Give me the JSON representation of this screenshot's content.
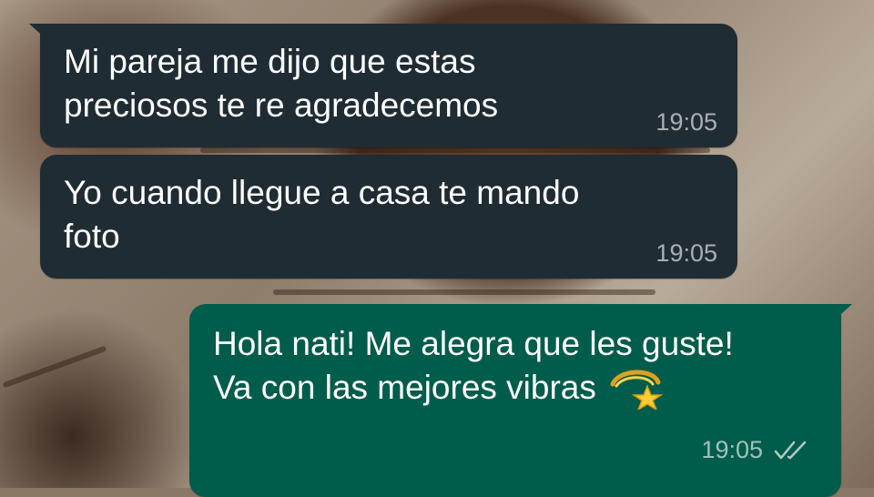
{
  "messages": [
    {
      "direction": "incoming",
      "text": "Mi pareja me dijo que estas\npreciosos te re agradecemos",
      "time": "19:05"
    },
    {
      "direction": "incoming",
      "text": "Yo cuando llegue a casa te mando\nfoto",
      "time": "19:05"
    },
    {
      "direction": "outgoing",
      "text_line1": "Hola nati! Me alegra que les guste!",
      "text_line2": "Va con las mejores vibras",
      "emoji": "dizzy-star-emoji",
      "time": "19:05",
      "status": "read-double-check-icon"
    }
  ],
  "colors": {
    "incoming_bubble": "#1f2c34",
    "outgoing_bubble": "#005c4b",
    "text": "#ffffff",
    "timestamp": "#a7b2b8",
    "read_ticks": "#b4c8c2"
  }
}
